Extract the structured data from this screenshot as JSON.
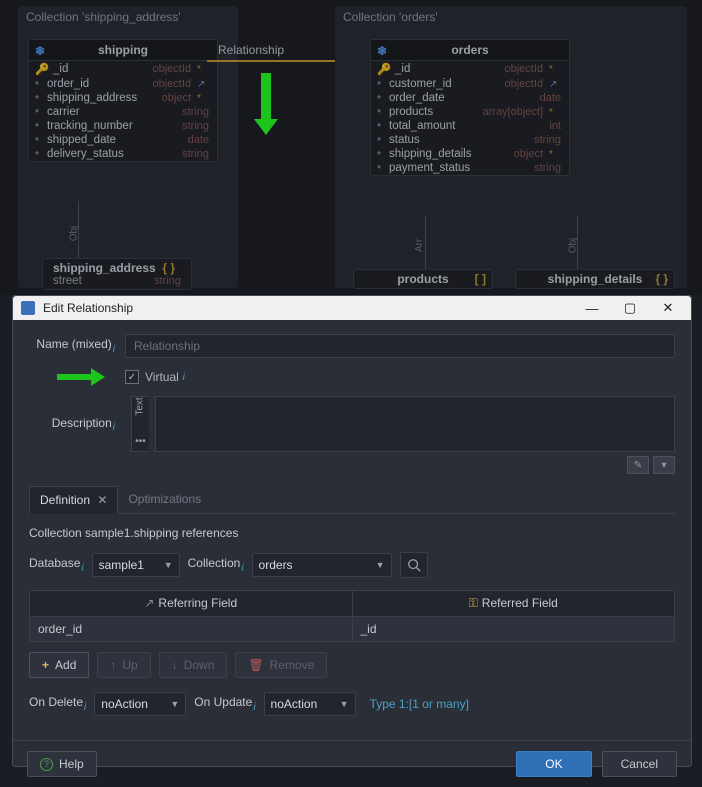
{
  "diagram": {
    "panels": {
      "left": "Collection 'shipping_address'",
      "right": "Collection 'orders'"
    },
    "relationship_label": "Relationship",
    "shipping": {
      "title": "shipping",
      "fields": [
        {
          "name": "_id",
          "type": "objectId",
          "key": true,
          "mark": "*"
        },
        {
          "name": "order_id",
          "type": "objectId",
          "mark": "↗"
        },
        {
          "name": "shipping_address",
          "type": "object",
          "mark": "*"
        },
        {
          "name": "carrier",
          "type": "string"
        },
        {
          "name": "tracking_number",
          "type": "string"
        },
        {
          "name": "shipped_date",
          "type": "date"
        },
        {
          "name": "delivery_status",
          "type": "string"
        }
      ]
    },
    "orders": {
      "title": "orders",
      "fields": [
        {
          "name": "_id",
          "type": "objectId",
          "key": true,
          "mark": "*"
        },
        {
          "name": "customer_id",
          "type": "objectId",
          "mark": "↗"
        },
        {
          "name": "order_date",
          "type": "date"
        },
        {
          "name": "products",
          "type": "array[object]",
          "mark": "*"
        },
        {
          "name": "total_amount",
          "type": "int"
        },
        {
          "name": "status",
          "type": "string"
        },
        {
          "name": "shipping_details",
          "type": "object",
          "mark": "*"
        },
        {
          "name": "payment_status",
          "type": "string"
        }
      ]
    },
    "sub_entities": {
      "shipping_address": "shipping_address",
      "ship_addr_field": "street",
      "ship_addr_type": "string",
      "products": "products",
      "shipping_details": "shipping_details"
    },
    "conn_labels": {
      "obj": "Obj",
      "arr": "Arr"
    }
  },
  "dialog": {
    "title": "Edit Relationship",
    "name_label": "Name (mixed)",
    "name_placeholder": "Relationship",
    "virtual_label": "Virtual",
    "virtual_checked": true,
    "description_label": "Description",
    "desc_tab": "Text",
    "desc_more": "•••",
    "tabs": {
      "definition": "Definition",
      "optimizations": "Optimizations"
    },
    "ref_text": "Collection sample1.shipping references",
    "database_label": "Database",
    "database_value": "sample1",
    "collection_label": "Collection",
    "collection_value": "orders",
    "table": {
      "referring_header": "Referring Field",
      "referred_header": "Referred Field",
      "referring_value": "order_id",
      "referred_value": "_id"
    },
    "buttons": {
      "add": "Add",
      "up": "Up",
      "down": "Down",
      "remove": "Remove"
    },
    "on_delete_label": "On Delete",
    "on_delete_value": "noAction",
    "on_update_label": "On Update",
    "on_update_value": "noAction",
    "cardinality": "Type 1:[1 or many]",
    "footer": {
      "help": "Help",
      "ok": "OK",
      "cancel": "Cancel"
    }
  }
}
